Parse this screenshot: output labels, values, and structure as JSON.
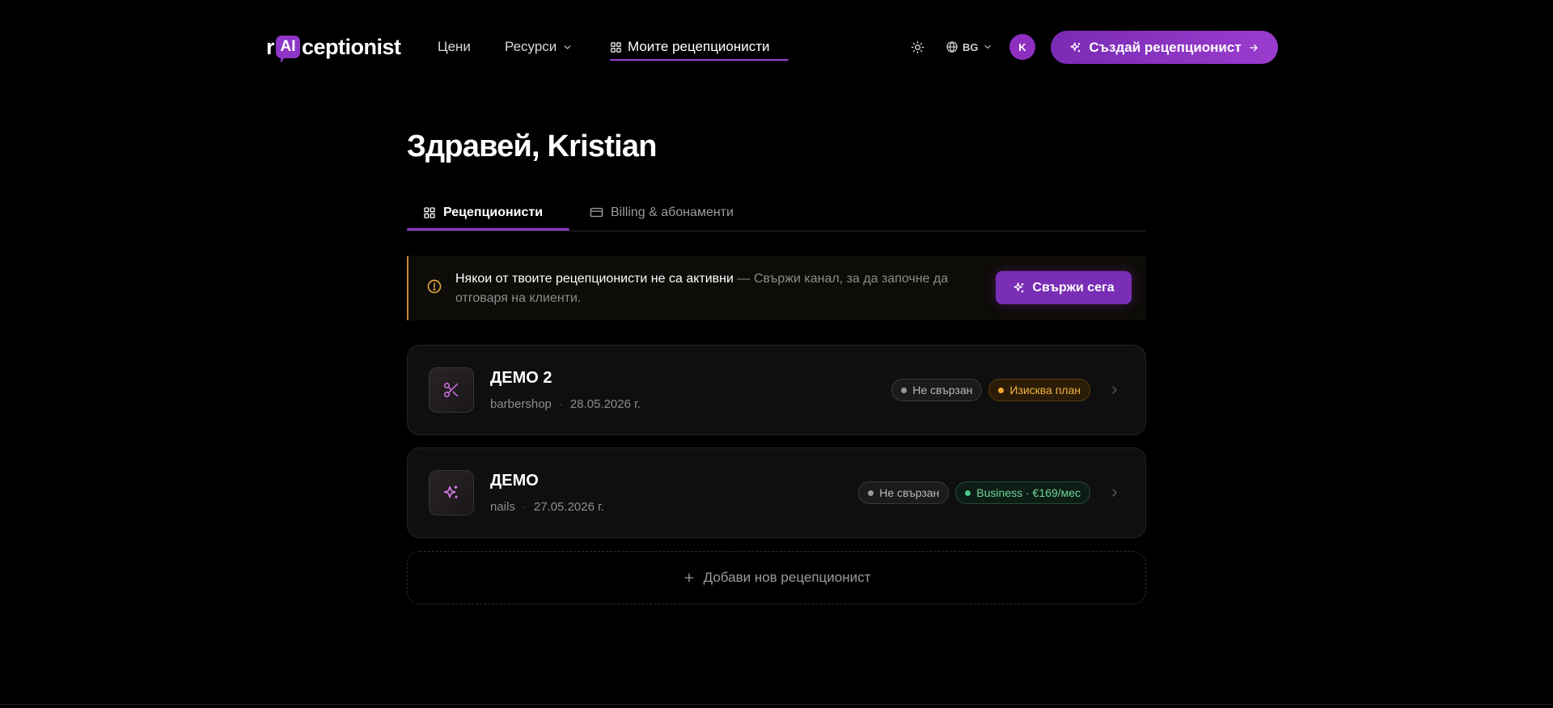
{
  "header": {
    "logo": {
      "prefix": "r",
      "badge": "AI",
      "suffix": "ceptionist"
    },
    "nav": [
      {
        "label": "Цени"
      },
      {
        "label": "Ресурси"
      },
      {
        "label": "Моите рецепционисти"
      }
    ],
    "language": "BG",
    "avatar_initial": "K",
    "create_label": "Създай рецепционист"
  },
  "main": {
    "greeting": "Здравей, Kristian",
    "tabs": [
      {
        "label": "Рецепционисти"
      },
      {
        "label": "Billing & абонаменти"
      }
    ],
    "alert": {
      "strong": "Някои от твоите рецепционисти не са активни",
      "rest": " — Свържи канал, за да започне да отговаря на клиенти.",
      "button": "Свържи сега"
    },
    "receptionists": [
      {
        "name": "ДЕМО 2",
        "category": "barbershop",
        "date": "28.05.2026 г.",
        "icon": "scissors-icon",
        "badges": [
          {
            "label": "Не свързан",
            "kind": "neutral"
          },
          {
            "label": "Изисква план",
            "kind": "warn"
          }
        ]
      },
      {
        "name": "ДЕМО",
        "category": "nails",
        "date": "27.05.2026 г.",
        "icon": "sparkles-icon",
        "badges": [
          {
            "label": "Не свързан",
            "kind": "neutral"
          },
          {
            "label": "Business · €169/мес",
            "kind": "ok"
          }
        ]
      }
    ],
    "add_label": "Добави нов рецепционист"
  },
  "colors": {
    "accent": "#8e36c8",
    "warning": "#f0b242",
    "success": "#6fd49a",
    "background": "#000000"
  }
}
